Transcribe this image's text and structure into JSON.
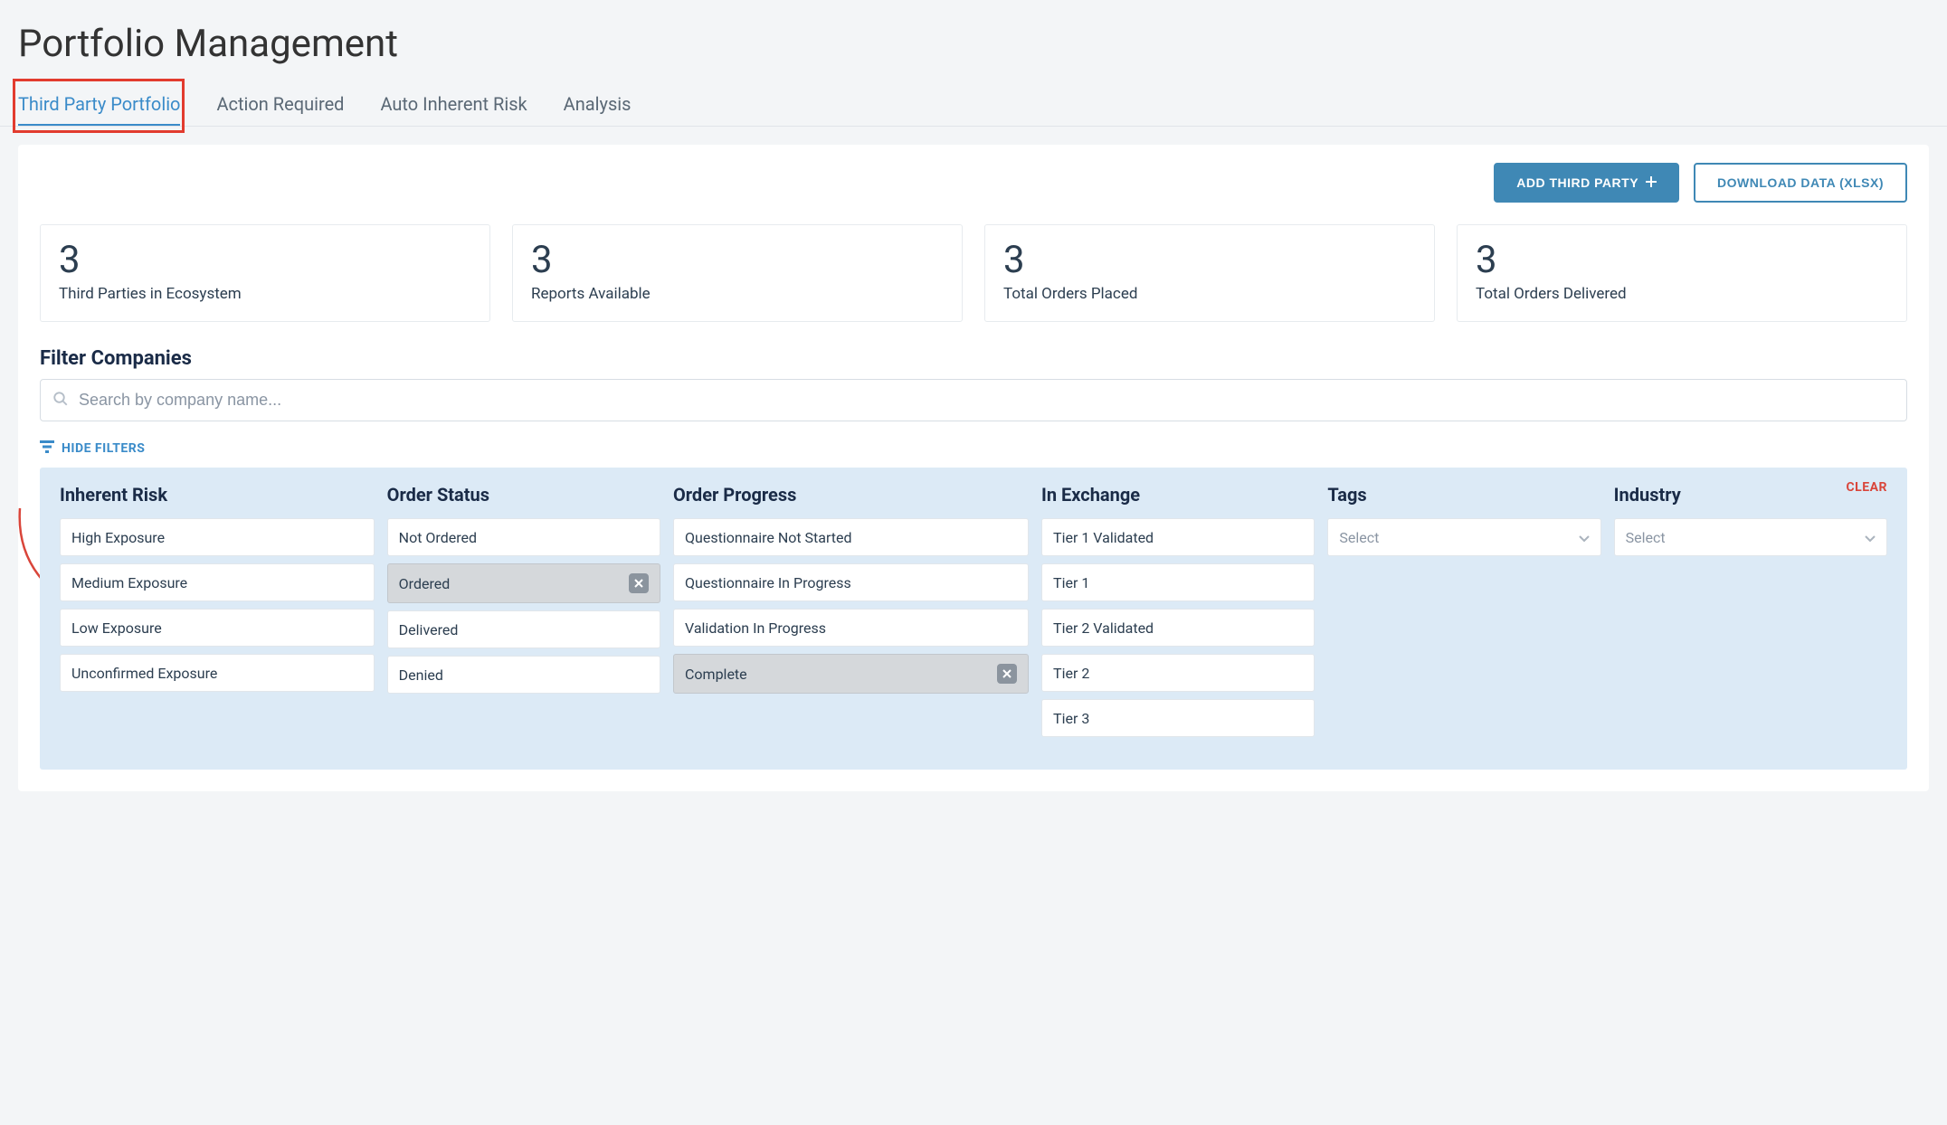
{
  "page_title": "Portfolio Management",
  "tabs": [
    {
      "label": "Third Party Portfolio",
      "active": true
    },
    {
      "label": "Action Required",
      "active": false
    },
    {
      "label": "Auto Inherent Risk",
      "active": false
    },
    {
      "label": "Analysis",
      "active": false
    }
  ],
  "actions": {
    "add_button": "ADD THIRD PARTY",
    "download_button": "DOWNLOAD DATA (XLSX)"
  },
  "stats": [
    {
      "value": "3",
      "label": "Third Parties in Ecosystem"
    },
    {
      "value": "3",
      "label": "Reports Available"
    },
    {
      "value": "3",
      "label": "Total Orders Placed"
    },
    {
      "value": "3",
      "label": "Total Orders Delivered"
    }
  ],
  "filter": {
    "section_title": "Filter Companies",
    "search_placeholder": "Search by company name...",
    "hide_filters_label": "HIDE FILTERS",
    "clear_label": "CLEAR",
    "columns": {
      "inherent_risk": {
        "header": "Inherent Risk",
        "options": [
          {
            "label": "High Exposure",
            "selected": false
          },
          {
            "label": "Medium Exposure",
            "selected": false
          },
          {
            "label": "Low Exposure",
            "selected": false
          },
          {
            "label": "Unconfirmed Exposure",
            "selected": false
          }
        ]
      },
      "order_status": {
        "header": "Order Status",
        "options": [
          {
            "label": "Not Ordered",
            "selected": false
          },
          {
            "label": "Ordered",
            "selected": true
          },
          {
            "label": "Delivered",
            "selected": false
          },
          {
            "label": "Denied",
            "selected": false
          }
        ]
      },
      "order_progress": {
        "header": "Order Progress",
        "options": [
          {
            "label": "Questionnaire Not Started",
            "selected": false
          },
          {
            "label": "Questionnaire In Progress",
            "selected": false
          },
          {
            "label": "Validation In Progress",
            "selected": false
          },
          {
            "label": "Complete",
            "selected": true
          }
        ]
      },
      "in_exchange": {
        "header": "In Exchange",
        "options": [
          {
            "label": "Tier 1 Validated",
            "selected": false
          },
          {
            "label": "Tier 1",
            "selected": false
          },
          {
            "label": "Tier 2 Validated",
            "selected": false
          },
          {
            "label": "Tier 2",
            "selected": false
          },
          {
            "label": "Tier 3",
            "selected": false
          }
        ]
      },
      "tags": {
        "header": "Tags",
        "placeholder": "Select"
      },
      "industry": {
        "header": "Industry",
        "placeholder": "Select"
      }
    }
  }
}
